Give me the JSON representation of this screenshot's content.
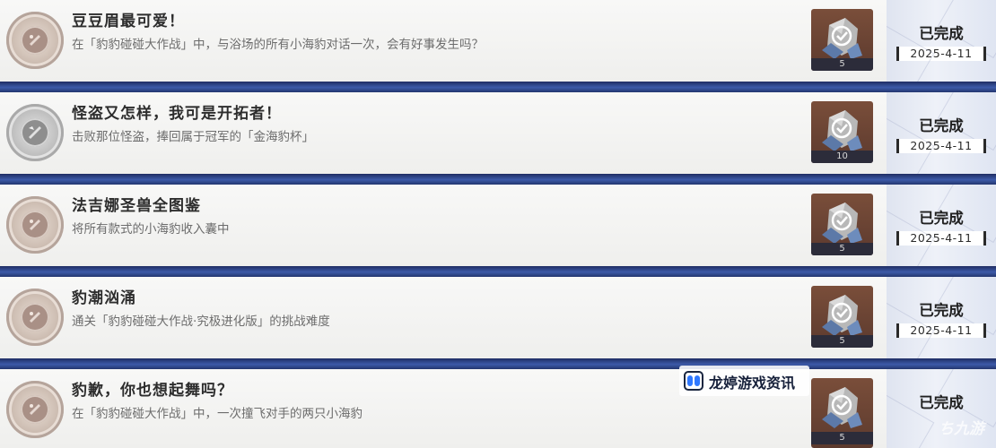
{
  "achievements": [
    {
      "title": "豆豆眉最可爱！",
      "description": "在「豹豹碰碰大作战」中，与浴场的所有小海豹对话一次，会有好事发生吗？",
      "medal": "bronze",
      "reward_qty": "5",
      "status": "已完成",
      "date": "2025-4-11"
    },
    {
      "title": "怪盗又怎样，我可是开拓者！",
      "description": "击败那位怪盗，捧回属于冠军的「金海豹杯」",
      "medal": "silver",
      "reward_qty": "10",
      "status": "已完成",
      "date": "2025-4-11"
    },
    {
      "title": "法吉娜圣兽全图鉴",
      "description": "将所有款式的小海豹收入囊中",
      "medal": "bronze",
      "reward_qty": "5",
      "status": "已完成",
      "date": "2025-4-11"
    },
    {
      "title": "豹潮汹涌",
      "description": "通关「豹豹碰碰大作战·究极进化版」的挑战难度",
      "medal": "bronze",
      "reward_qty": "5",
      "status": "已完成",
      "date": "2025-4-11"
    },
    {
      "title": "豹歉，你也想起舞吗？",
      "description": "在「豹豹碰碰大作战」中，一次撞飞对手的两只小海豹",
      "medal": "bronze",
      "reward_qty": "5",
      "status": "已完成",
      "date": ""
    }
  ],
  "watermark": {
    "text": "龙婷游戏资讯",
    "icon": "switch-icon"
  },
  "corner_logo": "ち九游",
  "colors": {
    "separator": "#3c5aa8",
    "reward_bg": "#6a4434",
    "status_panel": "#e6eaf4"
  }
}
